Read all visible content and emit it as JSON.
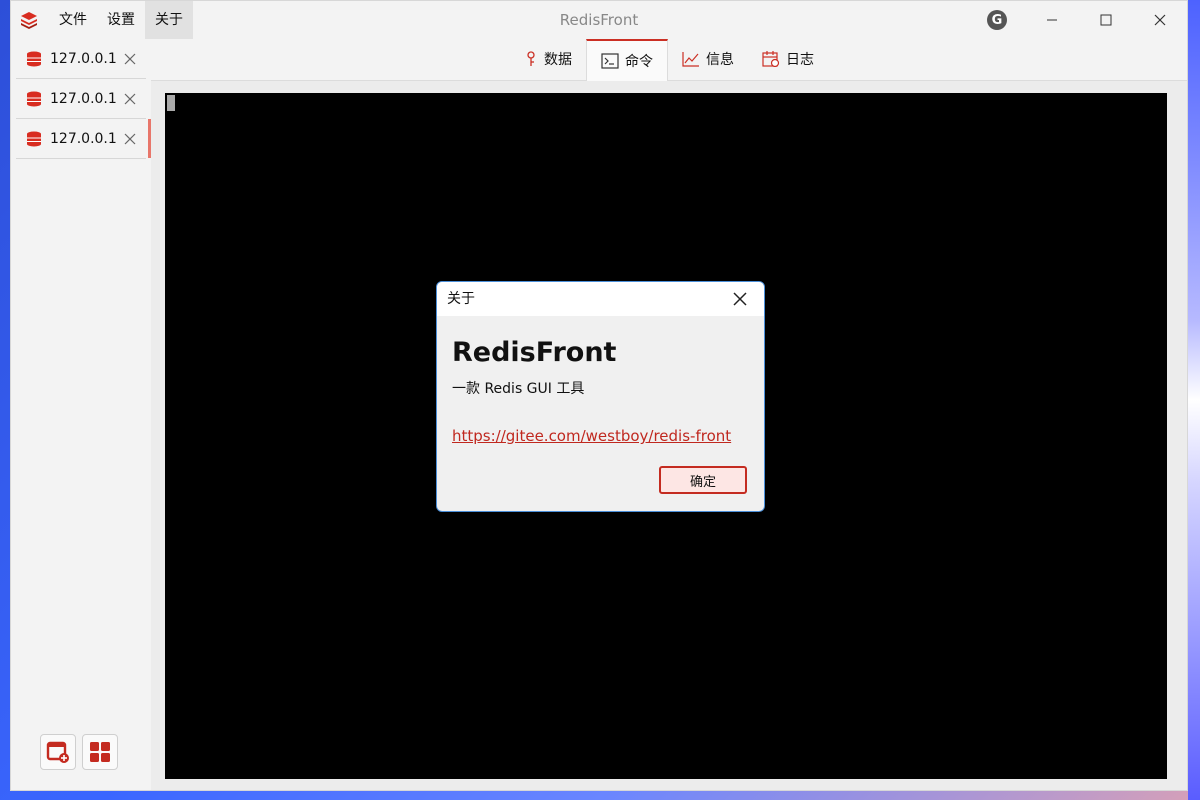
{
  "window": {
    "title": "RedisFront"
  },
  "menu": [
    "文件",
    "设置",
    "关于"
  ],
  "sidebar": {
    "connections": [
      {
        "label": "127.0.0.1"
      },
      {
        "label": "127.0.0.1"
      },
      {
        "label": "127.0.0.1"
      }
    ]
  },
  "tabs": [
    {
      "label": "数据",
      "icon": "key-icon"
    },
    {
      "label": "命令",
      "icon": "terminal-icon"
    },
    {
      "label": "信息",
      "icon": "chart-icon"
    },
    {
      "label": "日志",
      "icon": "calendar-icon"
    }
  ],
  "active_tab": "命令",
  "dialog": {
    "title": "关于",
    "app_name": "RedisFront",
    "description": "一款 Redis GUI 工具",
    "link": "https://gitee.com/westboy/redis-front",
    "ok_label": "确定"
  },
  "colors": {
    "accent": "#cb2f24",
    "link": "#c0281f",
    "terminal_bg": "#000000"
  }
}
